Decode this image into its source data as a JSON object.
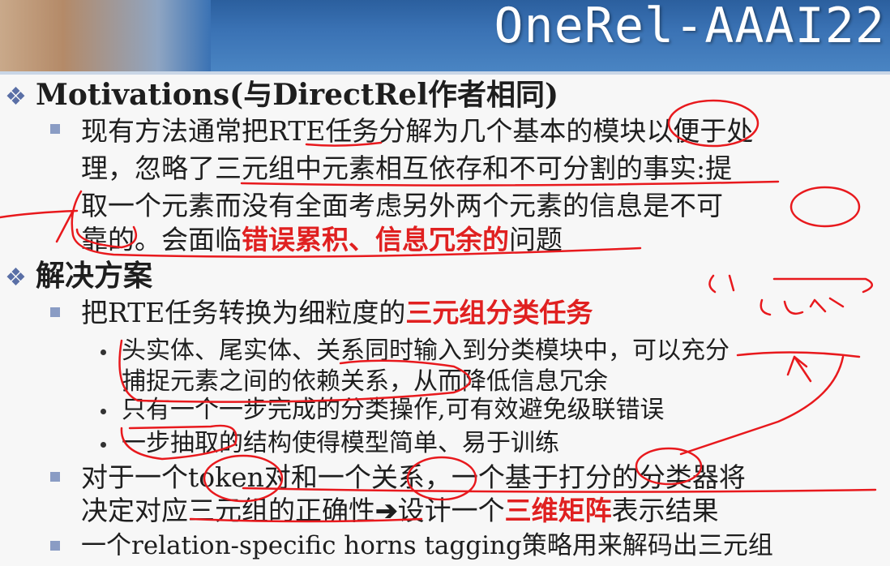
{
  "slide": {
    "title": "OneRel-AAAI22",
    "motivation_heading": "Motivations(与DirectRel作者相同)",
    "motivation_text": {
      "line1": "现有方法通常把RTE任务分解为几个基本的模块以便于处",
      "line2": "理，忽略了三元组中元素相互依存和不可分割的事实:提",
      "line3": "取一个元素而没有全面考虑另外两个元素的信息是不可",
      "line4_a": "靠的。会面临",
      "line4_red": "错误累积、信息冗余的",
      "line4_b": "问题"
    },
    "solution_heading": "解决方案",
    "solution_point1": {
      "text": "把RTE任务转换为细粒度的",
      "red": "三元组分类任务"
    },
    "sub_points": {
      "p1_line1": "头实体、尾实体、关系同时输入到分类模块中，可以充分",
      "p1_line2": "捕捉元素之间的依赖关系，从而降低信息冗余",
      "p2": "只有一个一步完成的分类操作,可有效避免级联错误",
      "p3": "一步抽取的结构使得模型简单、易于训练"
    },
    "solution_point2": {
      "line1": "对于一个token对和一个关系，一个基于打分的分类器将",
      "line2_a": "决定对应三元组的正确性",
      "arrow": "➔",
      "line2_b": "设计一个",
      "line2_red": "三维矩阵",
      "line2_c": "表示结果"
    },
    "solution_point3": "一个relation-specific horns tagging策略用来解码出三元组"
  },
  "colors": {
    "header_blue": "#3a72b4",
    "accent_red": "#e02020",
    "annotation_red": "#e8191d",
    "bullet_blue": "#8a9cc4"
  }
}
